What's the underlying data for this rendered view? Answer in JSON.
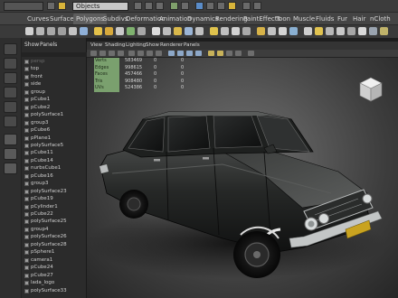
{
  "status_line": {
    "object_filter": "Objects"
  },
  "shelf_tabs": [
    "Curves",
    "Surfaces",
    "Polygons",
    "Subdivs",
    "Deformation",
    "Animation",
    "Dynamics",
    "Rendering",
    "PaintEffects",
    "Toon",
    "Muscle",
    "Fluids",
    "Fur",
    "Hair",
    "nCloth"
  ],
  "active_shelf_tab": "Polygons",
  "outliner": {
    "menu": [
      "Show",
      "Panels"
    ],
    "items": [
      {
        "label": "persp",
        "dim": true
      },
      {
        "label": "top"
      },
      {
        "label": "front"
      },
      {
        "label": "side"
      },
      {
        "label": "group"
      },
      {
        "label": "pCube1"
      },
      {
        "label": "pCube2"
      },
      {
        "label": "polySurface1"
      },
      {
        "label": "group3"
      },
      {
        "label": "pCube6"
      },
      {
        "label": "pPlane1"
      },
      {
        "label": "polySurface5"
      },
      {
        "label": "pCube11"
      },
      {
        "label": "pCube14"
      },
      {
        "label": "nurbsCube1"
      },
      {
        "label": "pCube16"
      },
      {
        "label": "group3"
      },
      {
        "label": "polySurface23"
      },
      {
        "label": "pCube19"
      },
      {
        "label": "pCylinder1"
      },
      {
        "label": "pCube22"
      },
      {
        "label": "polySurface25"
      },
      {
        "label": "group4"
      },
      {
        "label": "polySurface26"
      },
      {
        "label": "polySurface28"
      },
      {
        "label": "pSphere1"
      },
      {
        "label": "camera1"
      },
      {
        "label": "pCube24"
      },
      {
        "label": "pCube27"
      },
      {
        "label": "lada_logo"
      },
      {
        "label": "polySurface33"
      }
    ]
  },
  "viewport": {
    "menu": [
      "View",
      "Shading",
      "Lighting",
      "Show",
      "Renderer",
      "Panels"
    ],
    "hud": [
      {
        "label": "Verts",
        "value": "583469",
        "c1": "0",
        "c2": "0"
      },
      {
        "label": "Edges",
        "value": "998615",
        "c1": "0",
        "c2": "0"
      },
      {
        "label": "Faces",
        "value": "457466",
        "c1": "0",
        "c2": "0"
      },
      {
        "label": "Tris",
        "value": "908480",
        "c1": "0",
        "c2": "0"
      },
      {
        "label": "UVs",
        "value": "524386",
        "c1": "0",
        "c2": "0"
      }
    ]
  },
  "colors": {
    "ui_dark": "#2b2b2b",
    "hud_label_bg": "#7aa06e",
    "car_body": "#1c1e1d",
    "chrome": "#b9bcbc",
    "plate": "#c9a320"
  },
  "icons": [
    "select-tool-icon",
    "lasso-tool-icon",
    "move-tool-icon",
    "rotate-tool-icon",
    "scale-tool-icon",
    "view-cube-icon"
  ]
}
